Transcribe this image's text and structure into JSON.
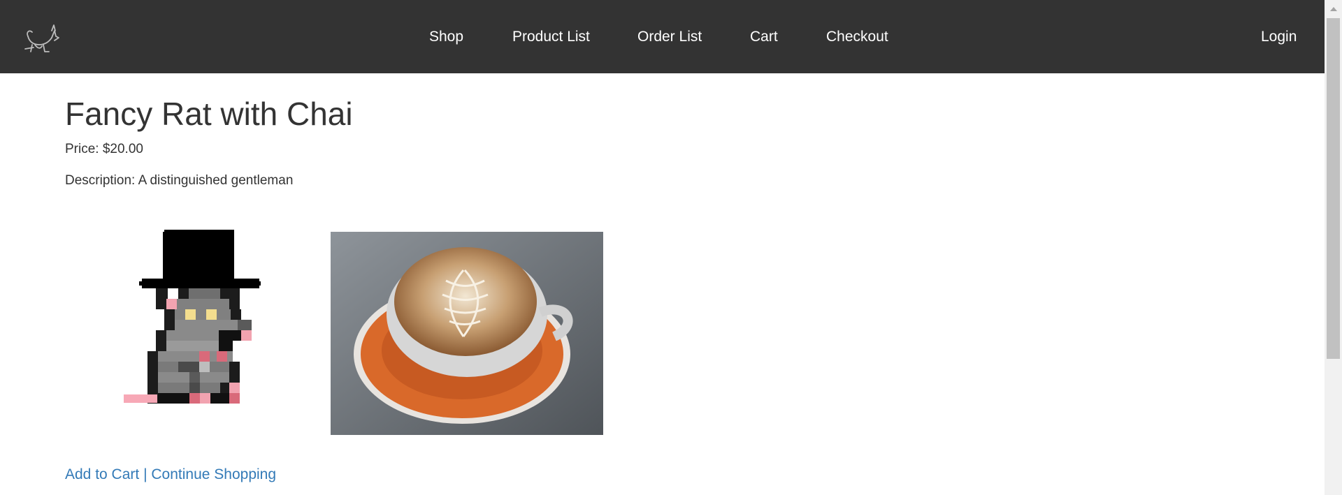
{
  "nav": {
    "logo_icon": "rat-logo-icon",
    "links": [
      "Shop",
      "Product List",
      "Order List",
      "Cart",
      "Checkout"
    ],
    "login": "Login"
  },
  "product": {
    "title": "Fancy Rat with Chai",
    "price_label": "Price:",
    "price_value": "$20.00",
    "description_label": "Description:",
    "description_value": "A distinguished gentleman"
  },
  "actions": {
    "add_to_cart": "Add to Cart",
    "separator": "|",
    "continue_shopping": "Continue Shopping"
  },
  "colors": {
    "navbar_bg": "#333333",
    "link": "#337ab7",
    "text": "#333333"
  }
}
